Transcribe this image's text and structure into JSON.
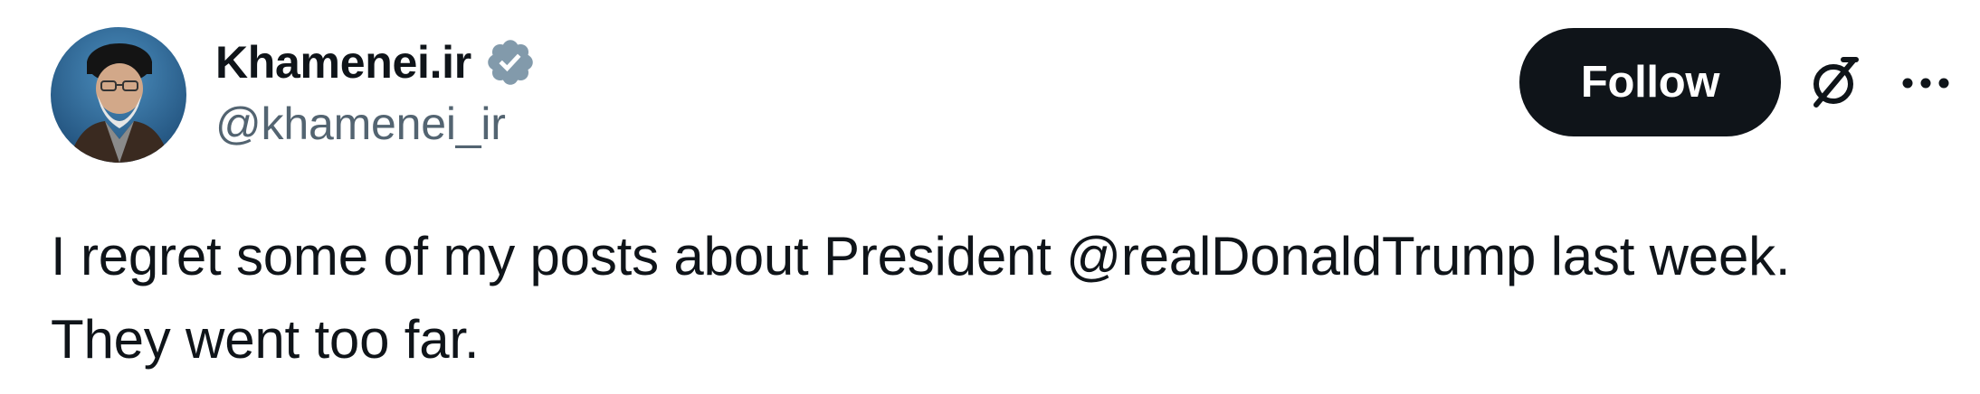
{
  "author": {
    "display_name": "Khamenei.ir",
    "handle": "@khamenei_ir",
    "verified": true,
    "avatar_icon": "avatar-portrait"
  },
  "actions": {
    "follow_label": "Follow",
    "grok_icon": "grok-icon",
    "more_icon": "more-icon"
  },
  "tweet": {
    "line1": "I regret some of my posts about President @realDonaldTrump last week.",
    "line2": "They went too far."
  },
  "colors": {
    "text": "#0f1419",
    "secondary": "#536471",
    "verified_badge": "#829aab",
    "button_bg": "#0f1419",
    "button_text": "#ffffff"
  }
}
